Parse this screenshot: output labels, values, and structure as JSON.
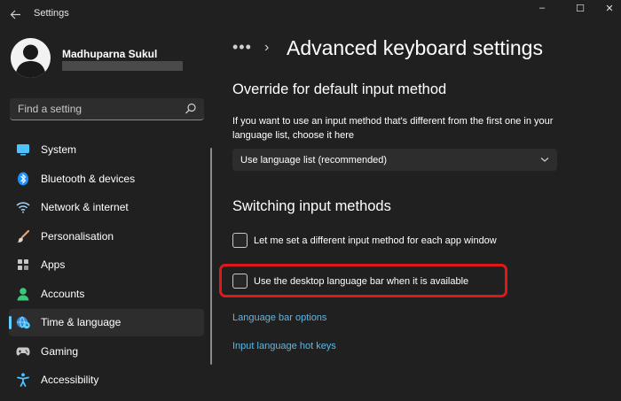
{
  "window": {
    "app_title": "Settings",
    "controls": {
      "minimize": "–",
      "maximize": "☐",
      "close": "✕"
    }
  },
  "profile": {
    "name": "Madhuparna Sukul"
  },
  "search": {
    "placeholder": "Find a setting",
    "value": ""
  },
  "sidebar": {
    "items": [
      {
        "label": "System",
        "icon": "monitor-icon",
        "selected": false
      },
      {
        "label": "Bluetooth & devices",
        "icon": "bluetooth-icon",
        "selected": false
      },
      {
        "label": "Network & internet",
        "icon": "wifi-icon",
        "selected": false
      },
      {
        "label": "Personalisation",
        "icon": "brush-icon",
        "selected": false
      },
      {
        "label": "Apps",
        "icon": "apps-icon",
        "selected": false
      },
      {
        "label": "Accounts",
        "icon": "person-icon",
        "selected": false
      },
      {
        "label": "Time & language",
        "icon": "globe-clock-icon",
        "selected": true
      },
      {
        "label": "Gaming",
        "icon": "gamepad-icon",
        "selected": false
      },
      {
        "label": "Accessibility",
        "icon": "accessibility-icon",
        "selected": false
      }
    ]
  },
  "main": {
    "breadcrumb_more": "•••",
    "breadcrumb_sep": "›",
    "title": "Advanced keyboard settings",
    "override": {
      "title": "Override for default input method",
      "description": "If you want to use an input method that's different from the first one in your language list, choose it here",
      "dropdown_value": "Use language list (recommended)"
    },
    "switching": {
      "title": "Switching input methods",
      "options": [
        {
          "label": "Let me set a different input method for each app window",
          "checked": false
        },
        {
          "label": "Use the desktop language bar when it is available",
          "checked": false
        }
      ]
    },
    "links": {
      "language_bar_options": "Language bar options",
      "input_language_hot_keys": "Input language hot keys"
    }
  },
  "colors": {
    "background": "#202020",
    "accent": "#60cdff",
    "link": "#5cb8e6",
    "highlight": "#e01818"
  }
}
